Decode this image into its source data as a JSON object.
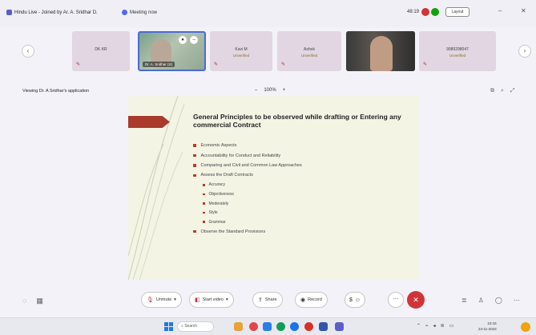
{
  "titlebar": {
    "app_title": "Hindu Live - Joined by Ar. A. Sridhar D.",
    "meeting_tab": "Meeting now",
    "timer": "48:19",
    "layout_button": "Layout",
    "minimize_glyph": "–",
    "close_glyph": "✕"
  },
  "strip": {
    "prev_glyph": "‹",
    "next_glyph": "›",
    "tiles": [
      {
        "name": "DK KR",
        "sub": ""
      },
      {
        "name": "Dr. A. Sridhar (S)",
        "sub": ""
      },
      {
        "name": "Kavi M",
        "sub": "Unverified"
      },
      {
        "name": "Ashok",
        "sub": "Unverified"
      },
      {
        "name": "",
        "sub": ""
      },
      {
        "name": "9989298047",
        "sub": "Unverified"
      }
    ]
  },
  "content": {
    "viewing": "Viewing Dr. A Sridhar's application",
    "zoom_minus": "–",
    "zoom_level": "100%",
    "zoom_plus": "+"
  },
  "slide": {
    "title": "General Principles to be observed while drafting or Entering any commercial Contract",
    "bullets": [
      "Economic Aspects",
      "Accountability for Conduct and Reliability",
      "Comparing and Civil and Common Law Approaches",
      "Assess the Draft Contracts"
    ],
    "sub_bullets": [
      "Accuracy",
      "Objectiveness",
      "Moderately",
      "Style",
      "Grammar"
    ],
    "last_bullet": "Observe the Standard Provisions"
  },
  "toolbar": {
    "unmute": "Unmute",
    "start_video": "Start video",
    "share": "Share",
    "record": "Record",
    "end_glyph": "✕"
  },
  "taskbar": {
    "search": "Search",
    "time": "10:15",
    "date": "24-11-2023"
  },
  "colors": {
    "accent": "#5b5fc7",
    "end_call": "#d13438",
    "slide_bullet": "#c0392b",
    "slide_bg": "#f3f4e4"
  }
}
